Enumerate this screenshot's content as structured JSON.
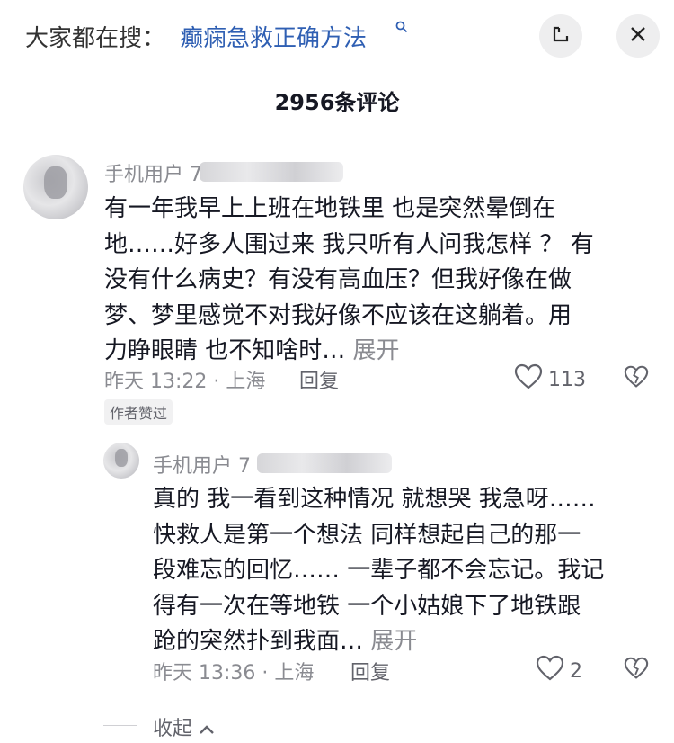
{
  "header": {
    "search_prefix": "大家都在搜：",
    "search_term": "癫痫急救正确方法",
    "search_icon": "search-icon",
    "shrink_icon": "shrink-icon",
    "close_icon": "close-icon"
  },
  "comments_count_title": "2956条评论",
  "comment": {
    "username": "手机用户 7",
    "lines": [
      "有一年我早上上班在地铁里  也是突然晕倒在",
      "地……好多人围过来 我只听有人问我怎样 ？ 有",
      "没有什么病史？有没有高血压？但我好像在做",
      "梦、梦里感觉不对我好像不应该在这躺着。用",
      "力睁眼睛 也不知啥时…"
    ],
    "expand": "展开",
    "meta": "昨天 13:22 · 上海",
    "reply": "回复",
    "likes": "113",
    "author_liked": "作者赞过"
  },
  "reply": {
    "username": "手机用户 7",
    "lines": [
      "真的 我一看到这种情况 就想哭  我急呀……",
      "快救人是第一个想法  同样想起自己的那一",
      "段难忘的回忆…… 一辈子都不会忘记。我记",
      "得有一次在等地铁 一个小姑娘下了地铁跟",
      "跄的突然扑到我面…"
    ],
    "expand": "展开",
    "meta": "昨天 13:36 · 上海",
    "reply": "回复",
    "likes": "2"
  },
  "collapse_label": "收起"
}
